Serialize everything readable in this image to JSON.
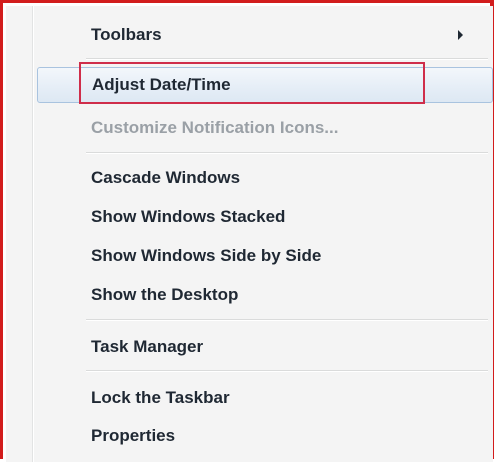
{
  "context_menu": {
    "items": [
      {
        "label": "Toolbars",
        "has_submenu": true,
        "enabled": true
      },
      {
        "label": "Adjust Date/Time",
        "highlighted": true,
        "enabled": true
      },
      {
        "label": "Customize Notification Icons...",
        "enabled": false
      },
      {
        "label": "Cascade Windows",
        "enabled": true
      },
      {
        "label": "Show Windows Stacked",
        "enabled": true
      },
      {
        "label": "Show Windows Side by Side",
        "enabled": true
      },
      {
        "label": "Show the Desktop",
        "enabled": true
      },
      {
        "label": "Task Manager",
        "enabled": true
      },
      {
        "label": "Lock the Taskbar",
        "enabled": true
      },
      {
        "label": "Properties",
        "enabled": true
      }
    ],
    "submenu_arrow_icon": "chevron-right-icon"
  },
  "colors": {
    "frame_border": "#d21c1c",
    "annotation_border": "#cf2d4a",
    "menu_background": "#f4f4f4",
    "text": "#1f2833",
    "disabled_text": "#9aa0a6",
    "highlight_border": "#a9c3df"
  }
}
